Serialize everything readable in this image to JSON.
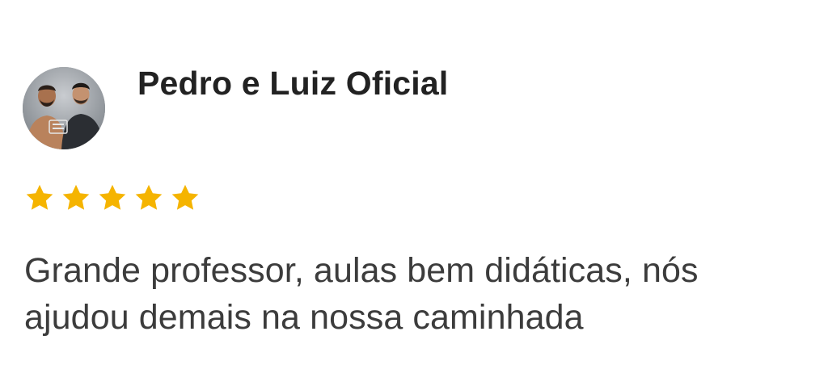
{
  "review": {
    "reviewer_name": "Pedro e Luiz Oficial",
    "avatar_icon": "avatar-photo-icon",
    "rating": 5,
    "rating_max": 5,
    "star_color": "#F5B400",
    "text_line_1": "Grande professor, aulas bem didáticas, nós",
    "text_line_2": "ajudou demais na nossa caminhada"
  }
}
